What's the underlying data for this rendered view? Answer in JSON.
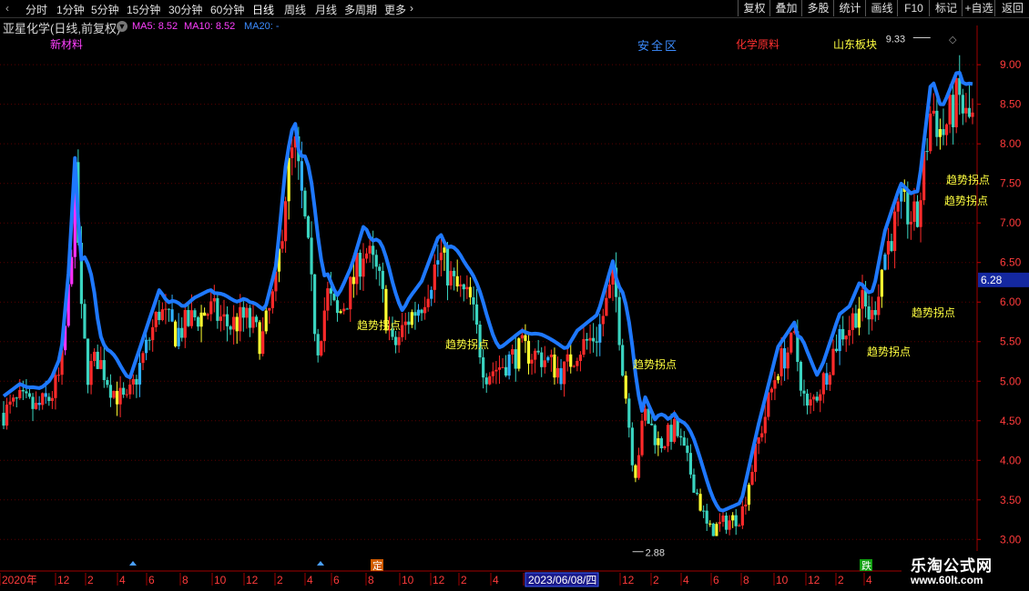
{
  "toolbar": {
    "timeframes": [
      "分时",
      "1分钟",
      "5分钟",
      "15分钟",
      "30分钟",
      "60分钟",
      "日线",
      "周线",
      "月线",
      "多周期",
      "更多"
    ],
    "active": "日线",
    "right_buttons": [
      "复权",
      "叠加",
      "多股",
      "统计",
      "画线",
      "F10",
      "标记",
      "+自选",
      "返回"
    ]
  },
  "stock": {
    "title": "亚星化学(日线,前复权)",
    "ma5": "MA5: 8.52",
    "ma10": "MA10: 8.52",
    "ma20": "MA20: -"
  },
  "tags": {
    "xincailiao": "新材料",
    "anquanqu": "安全区",
    "huaxue": "化学原料",
    "shandong": "山东板块"
  },
  "chart_data": {
    "type": "candlestick",
    "y_ticks": [
      "9.00",
      "8.50",
      "8.00",
      "7.50",
      "7.00",
      "6.50",
      "6.00",
      "5.50",
      "5.00",
      "4.50",
      "4.00",
      "3.50",
      "3.00"
    ],
    "ylim": [
      2.9,
      9.45
    ],
    "current_price": "6.28",
    "high_label": "9.33",
    "low_label": "2.88",
    "x_ticks": [
      "2020年",
      "12",
      "2",
      "4",
      "6",
      "8",
      "10",
      "12",
      "2",
      "4",
      "6",
      "8",
      "10",
      "12",
      "2",
      "4",
      "2023/06/08/四",
      "12",
      "2",
      "4",
      "6",
      "8",
      "10",
      "12",
      "2",
      "4"
    ],
    "signal_label": "趋势拐点",
    "events": [
      "定",
      "跌"
    ],
    "close_path": [
      [
        2019.82,
        4.6
      ],
      [
        2019.9,
        4.75
      ],
      [
        2019.98,
        4.65
      ],
      [
        2020.05,
        4.8
      ],
      [
        2020.1,
        5.1
      ],
      [
        2020.14,
        6.2
      ],
      [
        2020.17,
        7.6
      ],
      [
        2020.2,
        5.8
      ],
      [
        2020.23,
        5.1
      ],
      [
        2020.28,
        5.3
      ],
      [
        2020.35,
        4.9
      ],
      [
        2020.42,
        4.7
      ],
      [
        2020.5,
        5.3
      ],
      [
        2020.58,
        5.9
      ],
      [
        2020.66,
        5.6
      ],
      [
        2020.75,
        5.8
      ],
      [
        2020.83,
        5.9
      ],
      [
        2020.92,
        5.7
      ],
      [
        2021.0,
        5.8
      ],
      [
        2021.08,
        5.5
      ],
      [
        2021.15,
        6.2
      ],
      [
        2021.2,
        7.5
      ],
      [
        2021.24,
        8.0
      ],
      [
        2021.3,
        6.8
      ],
      [
        2021.35,
        5.4
      ],
      [
        2021.4,
        6.1
      ],
      [
        2021.45,
        5.8
      ],
      [
        2021.52,
        6.2
      ],
      [
        2021.58,
        6.7
      ],
      [
        2021.65,
        6.3
      ],
      [
        2021.72,
        5.4
      ],
      [
        2021.8,
        5.8
      ],
      [
        2021.86,
        6.0
      ],
      [
        2021.95,
        6.6
      ],
      [
        2022.02,
        6.2
      ],
      [
        2022.1,
        6.0
      ],
      [
        2022.17,
        5.1
      ],
      [
        2022.25,
        5.2
      ],
      [
        2022.35,
        5.4
      ],
      [
        2022.45,
        5.3
      ],
      [
        2022.55,
        5.1
      ],
      [
        2022.62,
        5.4
      ],
      [
        2022.72,
        5.6
      ],
      [
        2022.8,
        6.3
      ],
      [
        2022.85,
        5.0
      ],
      [
        2022.9,
        3.8
      ],
      [
        2022.95,
        4.6
      ],
      [
        2023.02,
        4.2
      ],
      [
        2023.1,
        4.4
      ],
      [
        2023.18,
        3.8
      ],
      [
        2023.26,
        3.1
      ],
      [
        2023.33,
        3.2
      ],
      [
        2023.42,
        3.3
      ],
      [
        2023.5,
        4.2
      ],
      [
        2023.6,
        5.2
      ],
      [
        2023.68,
        5.5
      ],
      [
        2023.74,
        4.6
      ],
      [
        2023.82,
        5.0
      ],
      [
        2023.9,
        5.6
      ],
      [
        2023.95,
        5.7
      ],
      [
        2024.0,
        6.0
      ],
      [
        2024.06,
        5.8
      ],
      [
        2024.12,
        6.6
      ],
      [
        2024.2,
        7.2
      ],
      [
        2024.28,
        7.0
      ],
      [
        2024.35,
        8.5
      ],
      [
        2024.4,
        8.1
      ],
      [
        2024.48,
        8.6
      ],
      [
        2024.52,
        8.3
      ]
    ]
  }
}
